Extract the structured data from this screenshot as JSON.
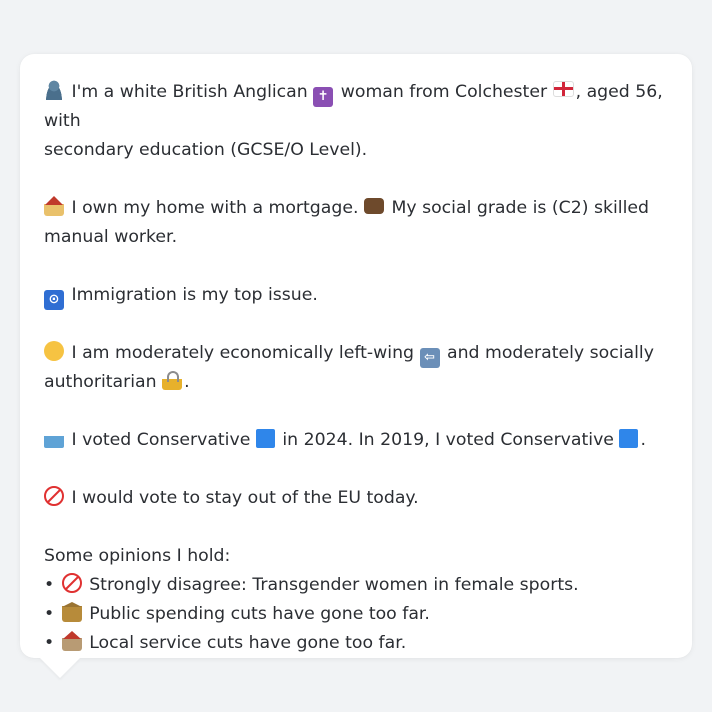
{
  "profile": {
    "line1_a": "I'm a white British Anglican",
    "line1_b": "woman from Colchester",
    "line1_c": ", aged 56, with",
    "line1_d": "secondary education (GCSE/O Level).",
    "line2_a": "I own my home with a mortgage.",
    "line2_b": "My social grade is (C2) skilled",
    "line2_c": "manual worker.",
    "line3": "Immigration is my top issue.",
    "line4_a": "I am moderately economically left-wing",
    "line4_b": "and moderately socially",
    "line4_c": "authoritarian",
    "line4_d": ".",
    "line5_a": "I voted Conservative",
    "line5_b": "in 2024. In 2019, I voted Conservative",
    "line5_c": ".",
    "line6": "I would vote to stay out of the EU today.",
    "opinions_heading": "Some opinions I hold:",
    "bullet_char": "•",
    "opinions": [
      "Strongly disagree: Transgender women in female sports.",
      "Public spending cuts have gone too far.",
      "Local service cuts have gone too far."
    ]
  },
  "icons": {
    "person": "bust-in-silhouette-icon",
    "cross": "latin-cross-icon",
    "flag": "england-flag-icon",
    "house": "house-icon",
    "briefcase": "briefcase-icon",
    "passport": "passport-control-icon",
    "thinking": "thinking-face-icon",
    "left_arrow": "left-arrow-icon",
    "lock": "lock-icon",
    "ballot": "ballot-box-icon",
    "blue_square": "blue-square-icon",
    "no_entry": "prohibited-icon",
    "bank": "classical-building-icon",
    "derelict": "derelict-house-icon"
  },
  "colors": {
    "background": "#f1f3f5",
    "bubble": "#ffffff",
    "text": "#2b2e33",
    "conservative_blue": "#2f86ea",
    "prohibited_red": "#e03131"
  }
}
